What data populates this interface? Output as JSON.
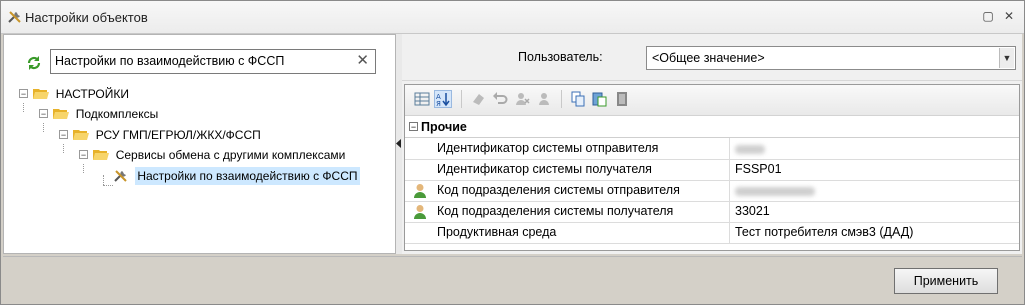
{
  "window": {
    "title": "Настройки объектов",
    "restore_glyph": "▢",
    "close_glyph": "✕"
  },
  "search": {
    "value": "Настройки по взаимодействию с ФССП",
    "clear_glyph": "✕"
  },
  "tree": {
    "nodes": [
      {
        "label": "НАСТРОЙКИ",
        "expander": "−"
      },
      {
        "label": "Подкомплексы",
        "expander": "−"
      },
      {
        "label": "РСУ ГМП/ЕГРЮЛ/ЖКХ/ФССП",
        "expander": "−"
      },
      {
        "label": "Сервисы обмена с другими комплексами",
        "expander": "−"
      },
      {
        "label": "Настройки по взаимодействию с ФССП",
        "selected": true
      }
    ]
  },
  "user": {
    "label": "Пользователь:",
    "value": "<Общее значение>",
    "arrow_glyph": "▼"
  },
  "properties": {
    "category": {
      "label": "Прочие",
      "expander": "−"
    },
    "rows": [
      {
        "name": "Идентификатор системы отправителя",
        "value": "",
        "blurred": true,
        "user_icon": false
      },
      {
        "name": "Идентификатор системы получателя",
        "value": "FSSP01",
        "blurred": false,
        "user_icon": false
      },
      {
        "name": "Код подразделения системы отправителя",
        "value": "",
        "blurred": true,
        "user_icon": true
      },
      {
        "name": "Код подразделения системы получателя",
        "value": "33021",
        "blurred": false,
        "user_icon": true
      },
      {
        "name": "Продуктивная среда",
        "value": "Тест потребителя смэв3 (ДАД)",
        "blurred": false,
        "user_icon": false
      }
    ]
  },
  "toolbar_icons": [
    "categorized-icon",
    "sort-az-icon",
    "eraser-icon",
    "undo-icon",
    "user-remove-icon",
    "user-icon",
    "copy-icon",
    "paste-icon",
    "book-icon"
  ],
  "footer": {
    "apply_label": "Применить"
  },
  "colors": {
    "selection": "#cde8ff",
    "folder": "#f5c542",
    "green": "#3a9a2a"
  }
}
